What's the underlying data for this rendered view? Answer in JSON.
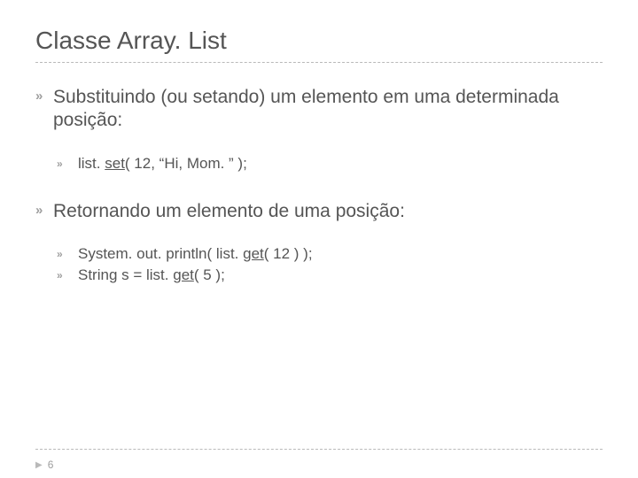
{
  "title": "Classe Array. List",
  "bullets": [
    {
      "text": "Substituindo (ou setando) um elemento em uma determinada posição:",
      "sub": [
        {
          "pre": "list. ",
          "u": "set",
          "post": "( 12, “Hi, Mom. ” );"
        }
      ]
    },
    {
      "text": "Retornando um elemento de uma posição:",
      "sub": [
        {
          "pre": "System. out. println( list. ",
          "u": "get",
          "post": "( 12 ) );"
        },
        {
          "pre": "String  s = list. ",
          "u": "get",
          "post": "( 5 );"
        }
      ]
    }
  ],
  "page": "6",
  "glyph": "»"
}
